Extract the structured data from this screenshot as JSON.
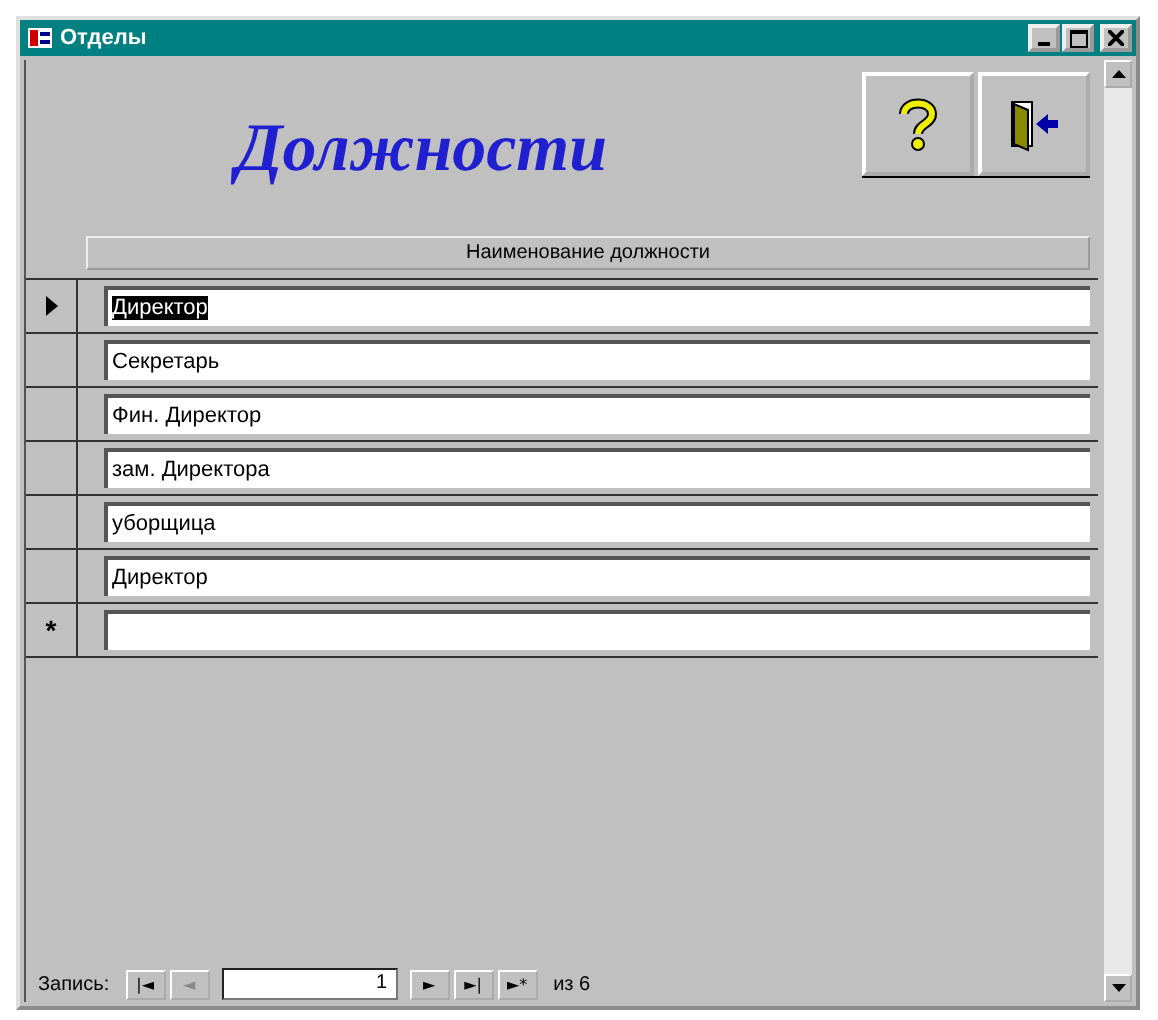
{
  "window": {
    "title": "Отделы"
  },
  "header": {
    "title": "Должности"
  },
  "table": {
    "columns": [
      "Наименование должности"
    ],
    "rows": [
      {
        "value": "Директор",
        "selected": true
      },
      {
        "value": "Секретарь",
        "selected": false
      },
      {
        "value": "Фин. Директор",
        "selected": false
      },
      {
        "value": "зам. Директора",
        "selected": false
      },
      {
        "value": "уборщица",
        "selected": false
      },
      {
        "value": "Директор",
        "selected": false
      }
    ],
    "new_row_marker": "*"
  },
  "record_nav": {
    "label": "Запись:",
    "before": [
      {
        "symbol": "|◄",
        "disabled": false
      },
      {
        "symbol": "◄",
        "disabled": true
      }
    ],
    "current": "1",
    "after": [
      {
        "symbol": "►",
        "disabled": false
      },
      {
        "symbol": "►|",
        "disabled": false
      },
      {
        "symbol": "►*",
        "disabled": false
      }
    ],
    "total": "из 6"
  }
}
